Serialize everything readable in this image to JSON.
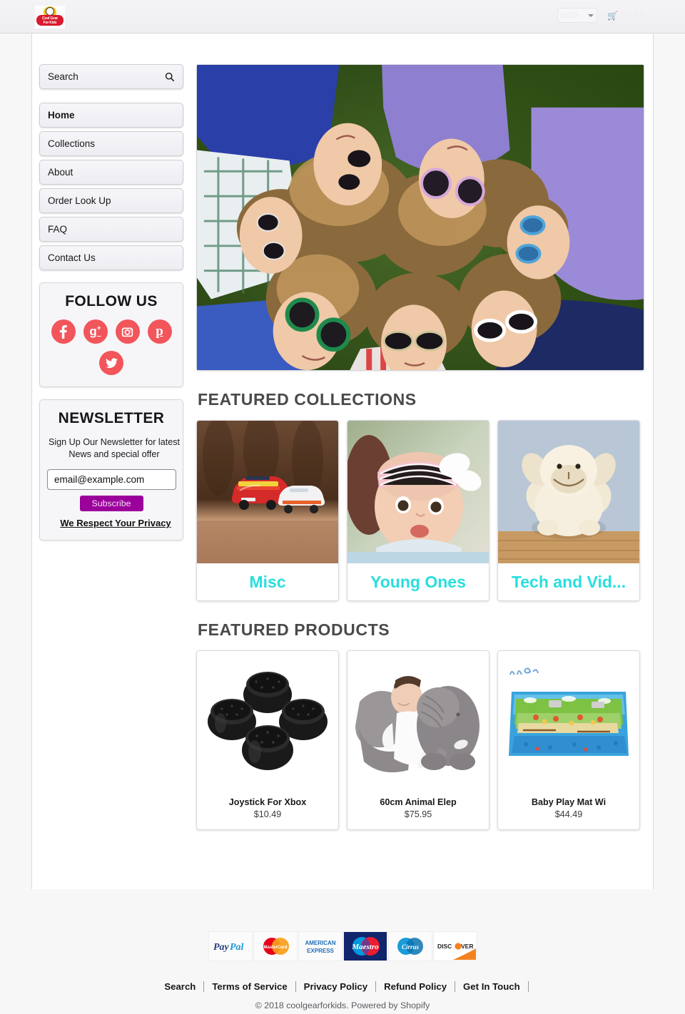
{
  "header": {
    "logo_alt": "Cool Gear For Kids",
    "logo_line1": "Cool Gear",
    "logo_line2": "For Kids",
    "currency": "USD",
    "cart_label": "CART",
    "cart_icon": "shopping-cart-icon"
  },
  "sidebar": {
    "search_placeholder": "Search",
    "search_icon": "search-icon",
    "nav": [
      {
        "label": "Home",
        "active": true
      },
      {
        "label": "Collections",
        "active": false
      },
      {
        "label": "About",
        "active": false
      },
      {
        "label": "Order Look Up",
        "active": false
      },
      {
        "label": "FAQ",
        "active": false
      },
      {
        "label": "Contact Us",
        "active": false
      }
    ],
    "follow": {
      "title": "FOLLOW US",
      "icons": [
        "facebook-icon",
        "google-plus-icon",
        "instagram-icon",
        "pinterest-icon",
        "twitter-icon"
      ],
      "color": "#f2555a"
    },
    "newsletter": {
      "title": "NEWSLETTER",
      "line1": "Sign Up Our Newsletter for latest",
      "line2": "News and special offer",
      "email_placeholder": "email@example.com",
      "subscribe_label": "Subscribe",
      "subscribe_color": "#9b009b",
      "privacy_label": "We Respect Your Privacy"
    }
  },
  "main": {
    "hero_alt": "Children lying in a circle on grass wearing sunglasses",
    "collections_title": "FEATURED COLLECTIONS",
    "collections": [
      {
        "title": "Misc",
        "image_alt": "Toy cars"
      },
      {
        "title": "Young Ones",
        "image_alt": "Baby with pink headband and white bow"
      },
      {
        "title": "Tech and Vid...",
        "image_alt": "Plush lamb toy"
      }
    ],
    "collection_title_color": "#29dede",
    "products_title": "FEATURED PRODUCTS",
    "products": [
      {
        "name": "Joystick For Xbox",
        "price": "$10.49",
        "image_alt": "Four black thumbstick caps"
      },
      {
        "name": "60cm Animal Elep",
        "price": "$75.95",
        "image_alt": "Baby sleeping on gray elephant plush pillow"
      },
      {
        "name": "Baby Play Mat Wi",
        "price": "$44.49",
        "image_alt": "Colorful baby play mat"
      }
    ]
  },
  "footer": {
    "payment_methods": [
      "PayPal",
      "MasterCard",
      "AMERICAN EXPRESS",
      "Maestro",
      "Cirrus",
      "DISCOVER"
    ],
    "links": [
      "Search",
      "Terms of Service",
      "Privacy Policy",
      "Refund Policy",
      "Get In Touch"
    ],
    "copyright": "© 2018 coolgearforkids. Powered by Shopify"
  }
}
